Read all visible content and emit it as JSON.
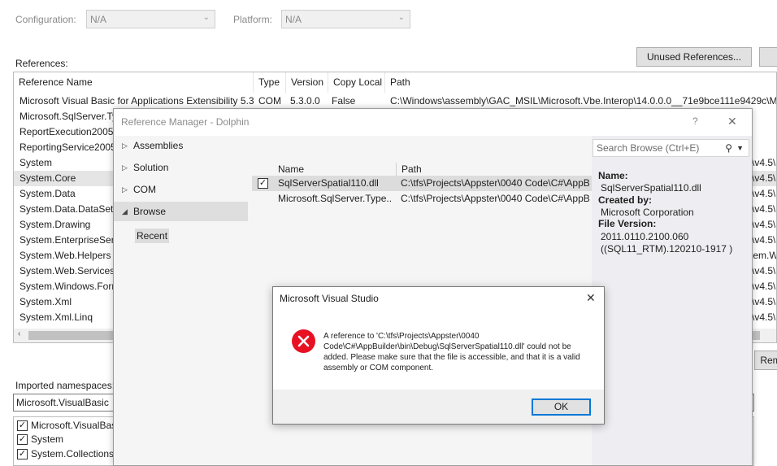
{
  "config": {
    "configuration_label": "Configuration:",
    "configuration_value": "N/A",
    "platform_label": "Platform:",
    "platform_value": "N/A"
  },
  "references": {
    "label": "References:",
    "unused_button": "Unused References...",
    "remove_button": "Rem",
    "columns": [
      "Reference Name",
      "Type",
      "Version",
      "Copy Local",
      "Path"
    ],
    "first_row": {
      "name": "Microsoft Visual Basic for Applications Extensibility 5.3",
      "type": "COM",
      "version": "5.3.0.0",
      "copy_local": "False",
      "path": "C:\\Windows\\assembly\\GAC_MSIL\\Microsoft.Vbe.Interop\\14.0.0.0__71e9bce111e9429c\\Mic"
    },
    "rows": [
      "Microsoft.SqlServer.Ty",
      "ReportExecution2005",
      "ReportingService2005",
      "System",
      "System.Core",
      "System.Data",
      "System.Data.DataSetE",
      "System.Drawing",
      "System.EnterpriseServ",
      "System.Web.Helpers",
      "System.Web.Services",
      "System.Windows.Forr",
      "System.Xml",
      "System.Xml.Linq"
    ],
    "right_tails": [
      "\\v4.5\\",
      "\\v4.5\\",
      "\\v4.5\\",
      "\\v4.5\\",
      "\\v4.5\\",
      "\\v4.5\\",
      "tem.W",
      "\\v4.5\\",
      "\\v4.5\\",
      "\\v4.5\\",
      "\\v4.5\\"
    ]
  },
  "imported": {
    "label": "Imported namespaces:",
    "input_value": "Microsoft.VisualBasic",
    "items": [
      "Microsoft.VisualBas",
      "System",
      "System.Collections"
    ]
  },
  "ref_manager": {
    "title": "Reference Manager - Dolphin",
    "help": "?",
    "close": "✕",
    "nav": [
      "Assemblies",
      "Solution",
      "COM",
      "Browse"
    ],
    "recent": "Recent",
    "search_placeholder": "Search Browse (Ctrl+E)",
    "grid_columns": [
      "Name",
      "Path"
    ],
    "grid_rows": [
      {
        "name": "SqlServerSpatial110.dll",
        "path": "C:\\tfs\\Projects\\Appster\\0040 Code\\C#\\AppB",
        "checked": true
      },
      {
        "name": "Microsoft.SqlServer.Type...",
        "path": "C:\\tfs\\Projects\\Appster\\0040 Code\\C#\\AppB",
        "checked": false
      }
    ],
    "details": {
      "name_label": "Name:",
      "name_value": "SqlServerSpatial110.dll",
      "created_label": "Created by:",
      "created_value": "Microsoft Corporation",
      "version_label": "File Version:",
      "version_value1": "2011.0110.2100.060",
      "version_value2": "((SQL11_RTM).120210-1917 )"
    }
  },
  "error_dialog": {
    "title": "Microsoft Visual Studio",
    "close": "✕",
    "message": "A reference to 'C:\\tfs\\Projects\\Appster\\0040 Code\\C#\\AppBuilder\\bin\\Debug\\SqlServerSpatial110.dll' could not be added. Please make sure that the file is accessible, and that it is a valid assembly or COM component.",
    "ok": "OK"
  },
  "colors": {
    "accent": "#0078d7",
    "error": "#e81123"
  }
}
